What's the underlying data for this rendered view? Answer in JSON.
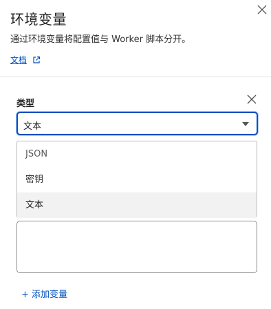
{
  "panel": {
    "title": "环境变量",
    "description": "通过环境变量将配置值与 Worker 脚本分开。",
    "docs_link": "文档"
  },
  "variable": {
    "type_label": "类型",
    "selected_type": "文本",
    "options": [
      "JSON",
      "密钥",
      "文本"
    ]
  },
  "actions": {
    "add_variable": "+ 添加变量"
  },
  "colors": {
    "accent": "#0051c3",
    "border": "#b9b9b9",
    "highlight_option": "#f2f2f2"
  }
}
